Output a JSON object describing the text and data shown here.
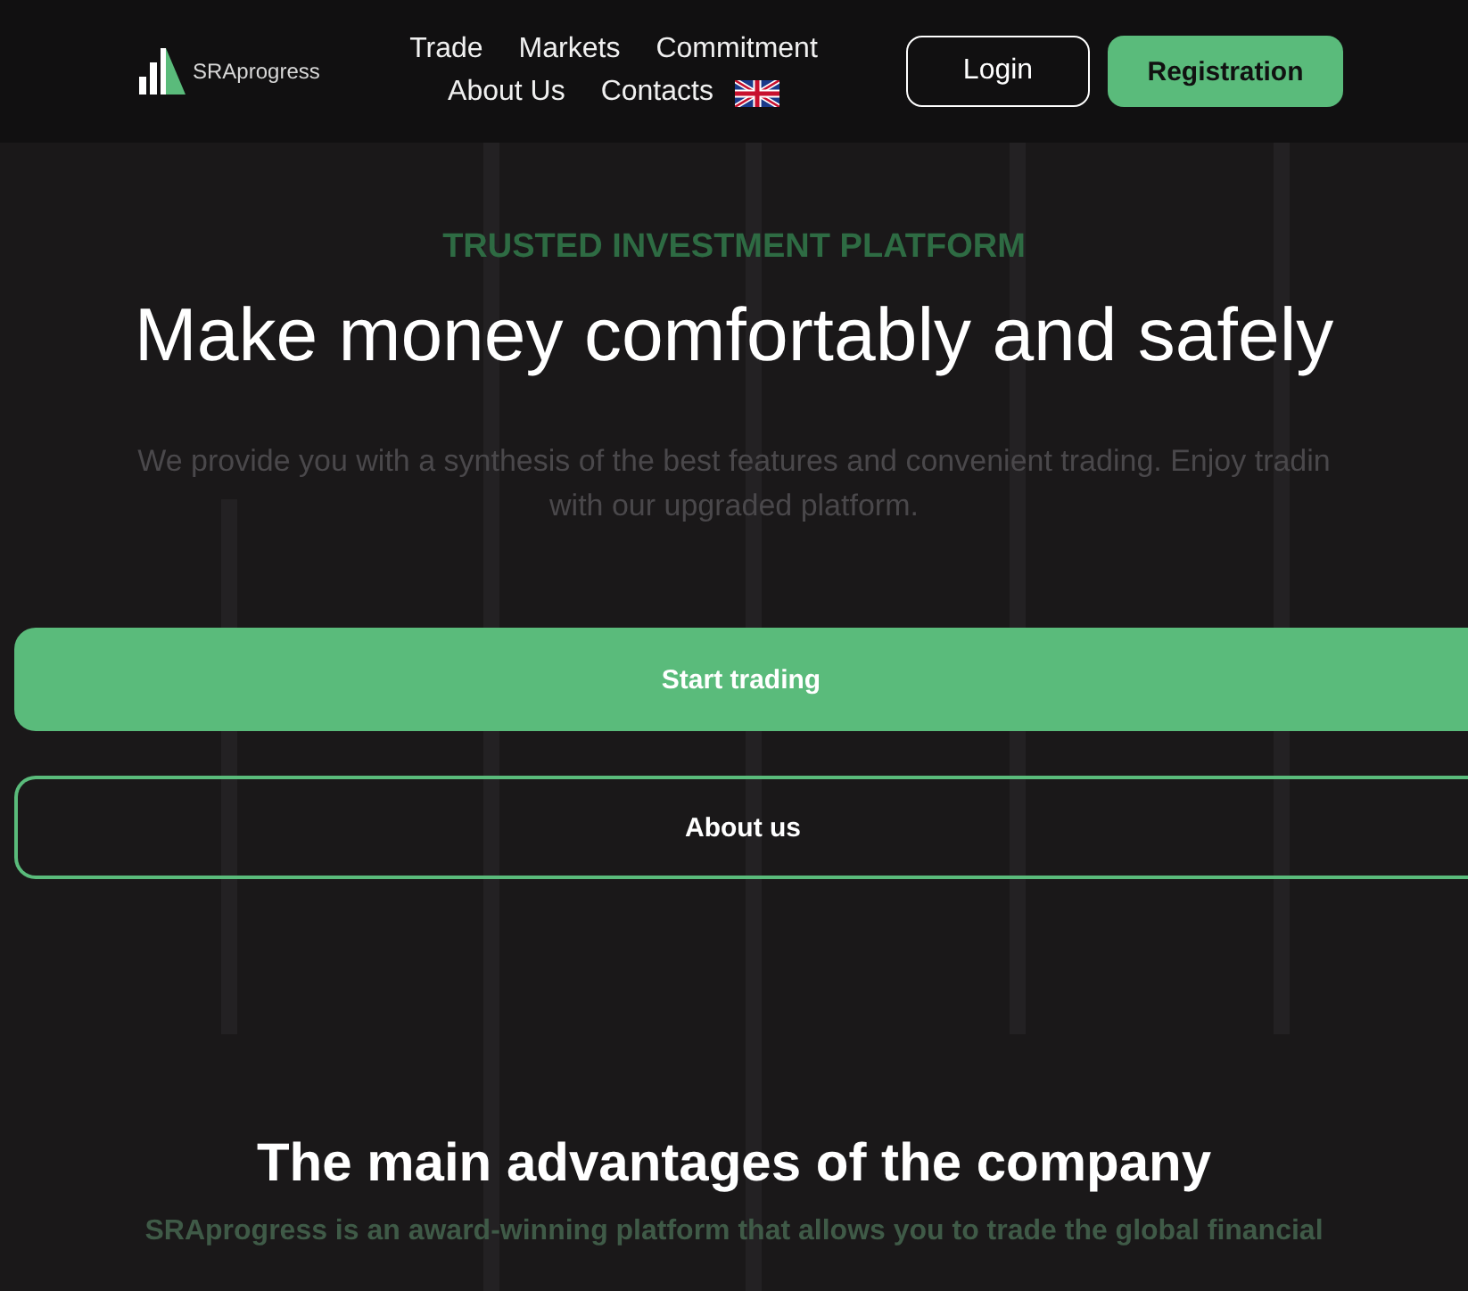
{
  "header": {
    "logo": "SRAprogress",
    "nav": [
      {
        "label": "Trade"
      },
      {
        "label": "Markets"
      },
      {
        "label": "Commitment"
      },
      {
        "label": "About Us"
      },
      {
        "label": "Contacts"
      }
    ],
    "login": "Login",
    "register": "Registration"
  },
  "hero": {
    "eyebrow": "TRUSTED INVESTMENT PLATFORM",
    "title": "Make money comfortably and safely",
    "subtitle_lines": [
      "We provide you with a synthesis of the best features and convenient trading. Enjoy tradin",
      "with our upgraded platform."
    ],
    "primary_button": "Start trading",
    "secondary_button": "About us"
  },
  "advantages": {
    "title": "The main advantages of the company",
    "intro": "SRAprogress is an award-winning platform that allows you to trade the global financial"
  }
}
